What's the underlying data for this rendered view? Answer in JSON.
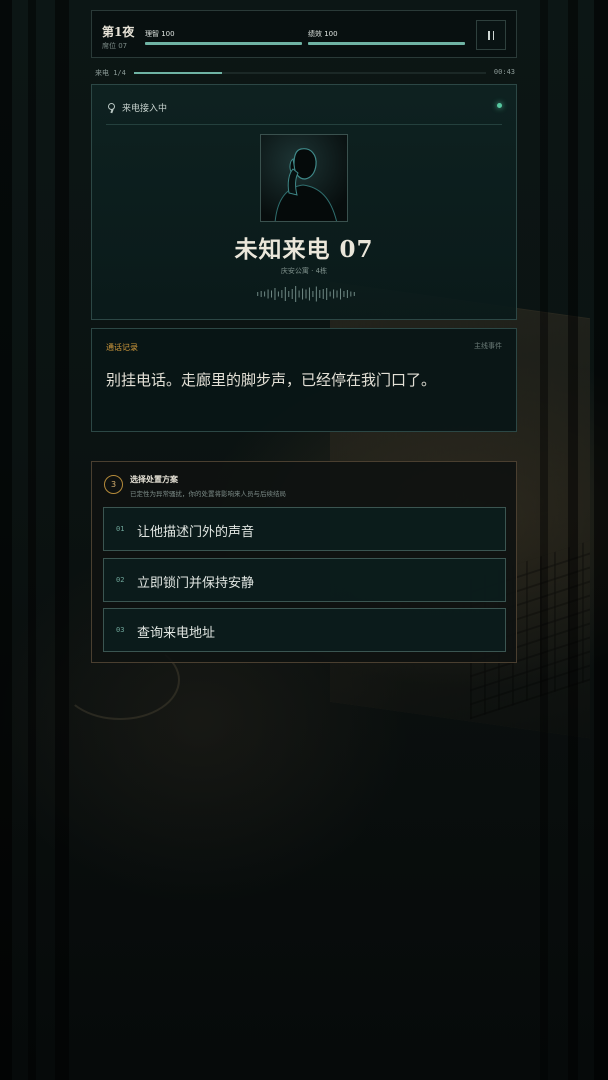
{
  "hud": {
    "night": "第1夜",
    "seat": "席位 07",
    "stats": [
      {
        "label": "理智 100",
        "value": 100,
        "max": 100
      },
      {
        "label": "绩效 100",
        "value": 100,
        "max": 100
      }
    ],
    "pause_icon": "pause-icon"
  },
  "call_progress": {
    "label": "来电 1/4",
    "fraction": 0.25,
    "timer": "00:43"
  },
  "caller": {
    "status": "来电接入中",
    "status_icon": "search-icon",
    "status_color": "#57c8a0",
    "name": "未知来电 07",
    "location": "庆安公寓 · 4栋"
  },
  "transcript": {
    "title": "通话记录",
    "tag": "主线事件",
    "line": "别挂电话。走廊里的脚步声，已经停在我门口了。"
  },
  "choices": {
    "step": "3",
    "title": "选择处置方案",
    "subtitle": "已定性为异常骚扰，你的处置将影响来人员与后续结局",
    "options": [
      {
        "num": "01",
        "label": "让他描述门外的声音"
      },
      {
        "num": "02",
        "label": "立即锁门并保持安静"
      },
      {
        "num": "03",
        "label": "查询来电地址"
      }
    ]
  },
  "colors": {
    "accent": "#6fb3a4",
    "gold": "#d19a3c",
    "panel_border": "#2c4745"
  }
}
